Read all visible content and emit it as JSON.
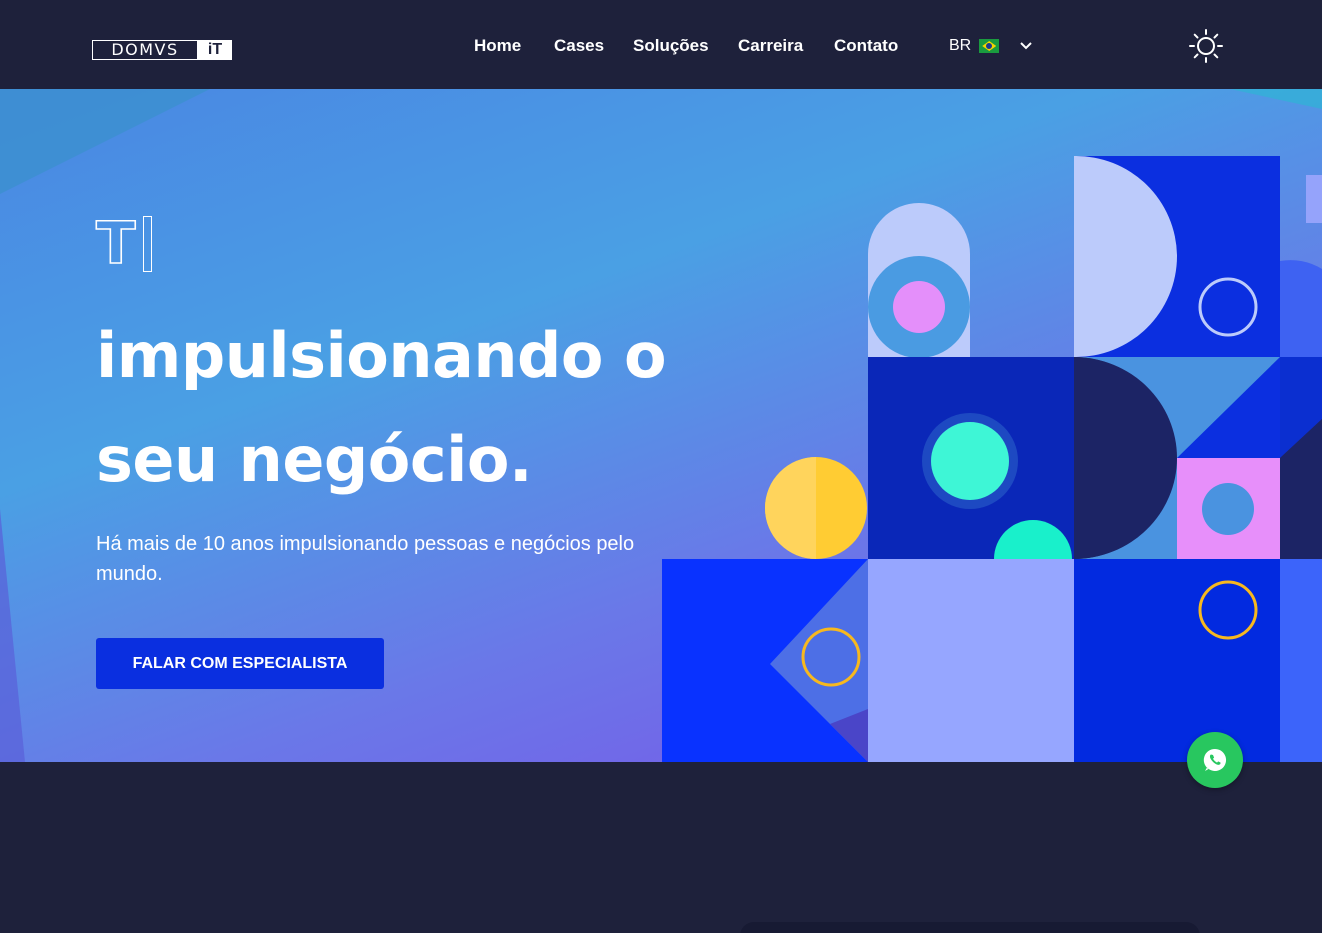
{
  "header": {
    "logo_main": "DOMVS",
    "logo_suffix": "iT",
    "nav": [
      "Home",
      "Cases",
      "Soluções",
      "Carreira",
      "Contato"
    ],
    "language": "BR",
    "flag_icon": "brazil-flag-icon",
    "language_chevron_icon": "chevron-down-icon",
    "theme_toggle_icon": "sun-icon"
  },
  "hero": {
    "mark": "T",
    "headline_line1": "impulsionando o",
    "headline_line2": "seu negócio.",
    "subtitle": "Há mais de 10 anos impulsionando pessoas e negócios pelo mundo.",
    "cta": "FALAR COM ESPECIALISTA"
  },
  "whatsapp_icon": "whatsapp-icon",
  "colors": {
    "background": "#1e213b",
    "accent": "#0a2fe0",
    "whatsapp": "#28c75f"
  }
}
